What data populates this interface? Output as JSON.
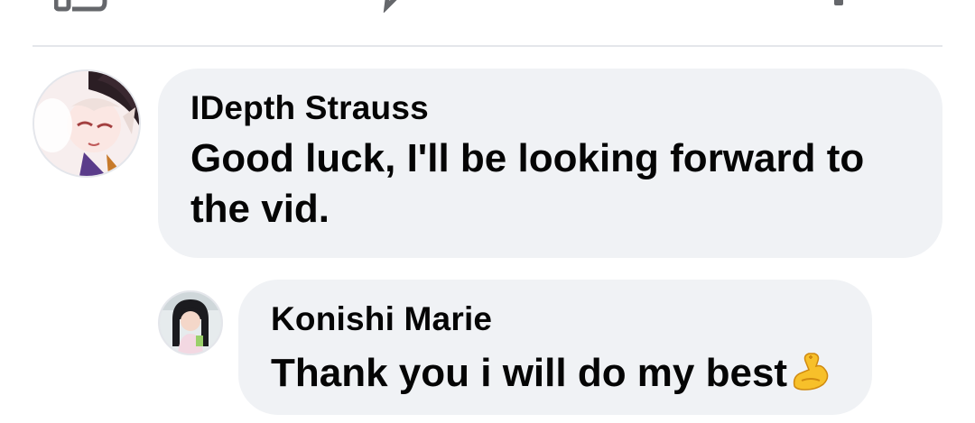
{
  "action_bar": {
    "like_icon": "thumbs-up-icon",
    "comment_icon": "comment-bubble-icon",
    "share_icon": "share-arrow-icon"
  },
  "comments": [
    {
      "author": "IDepth Strauss",
      "text": "Good luck, I'll be looking forward to the vid.",
      "avatar_icon": "anime-character-avatar"
    },
    {
      "author": "Konishi Marie",
      "text": "Thank you i will do my best",
      "emoji": "flexed-biceps-emoji",
      "avatar_icon": "user-photo-avatar"
    }
  ],
  "colors": {
    "bubble": "#f0f2f5",
    "text": "#050505",
    "divider": "#e4e6eb",
    "icon": "#65676b"
  }
}
